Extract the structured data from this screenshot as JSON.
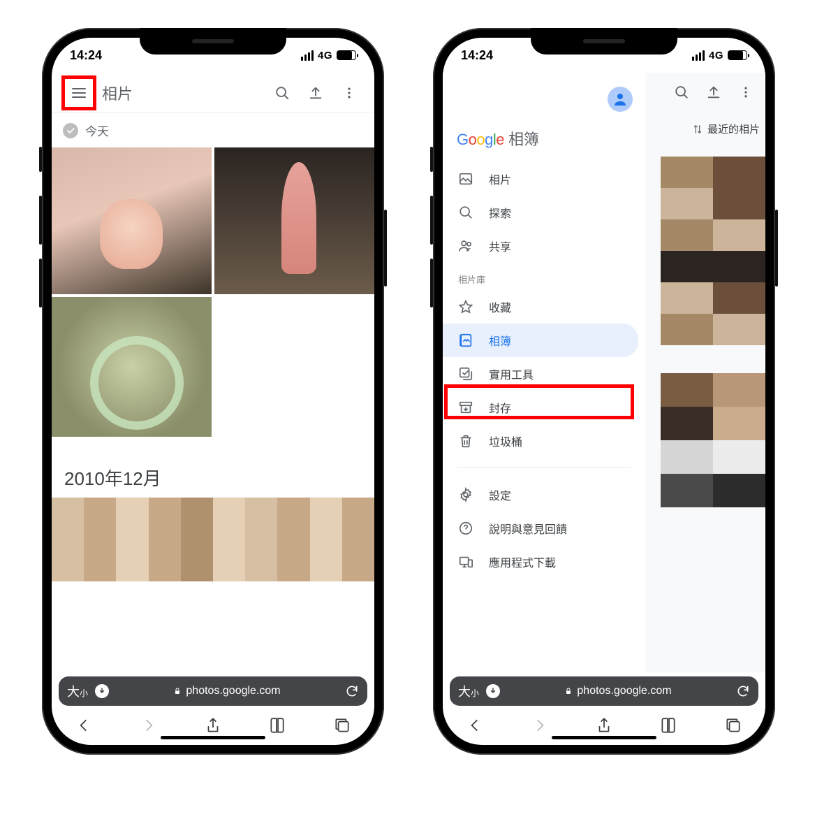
{
  "status": {
    "time": "14:24",
    "network": "4G"
  },
  "left": {
    "appbar_title": "相片",
    "today_label": "今天",
    "section2_title": "2010年12月"
  },
  "right": {
    "brand_suffix": "相簿",
    "sort_label": "最近的相片",
    "section_library_label": "相片庫",
    "nav": {
      "photos": "相片",
      "explore": "探索",
      "sharing": "共享",
      "favorites": "收藏",
      "albums": "相簿",
      "utilities": "實用工具",
      "archive": "封存",
      "trash": "垃圾桶",
      "settings": "設定",
      "help": "說明與意見回饋",
      "app_download": "應用程式下載"
    }
  },
  "safari": {
    "text_size_label": "大",
    "text_size_small": "小",
    "url": "photos.google.com"
  },
  "google_letters": [
    "G",
    "o",
    "o",
    "g",
    "l",
    "e"
  ]
}
